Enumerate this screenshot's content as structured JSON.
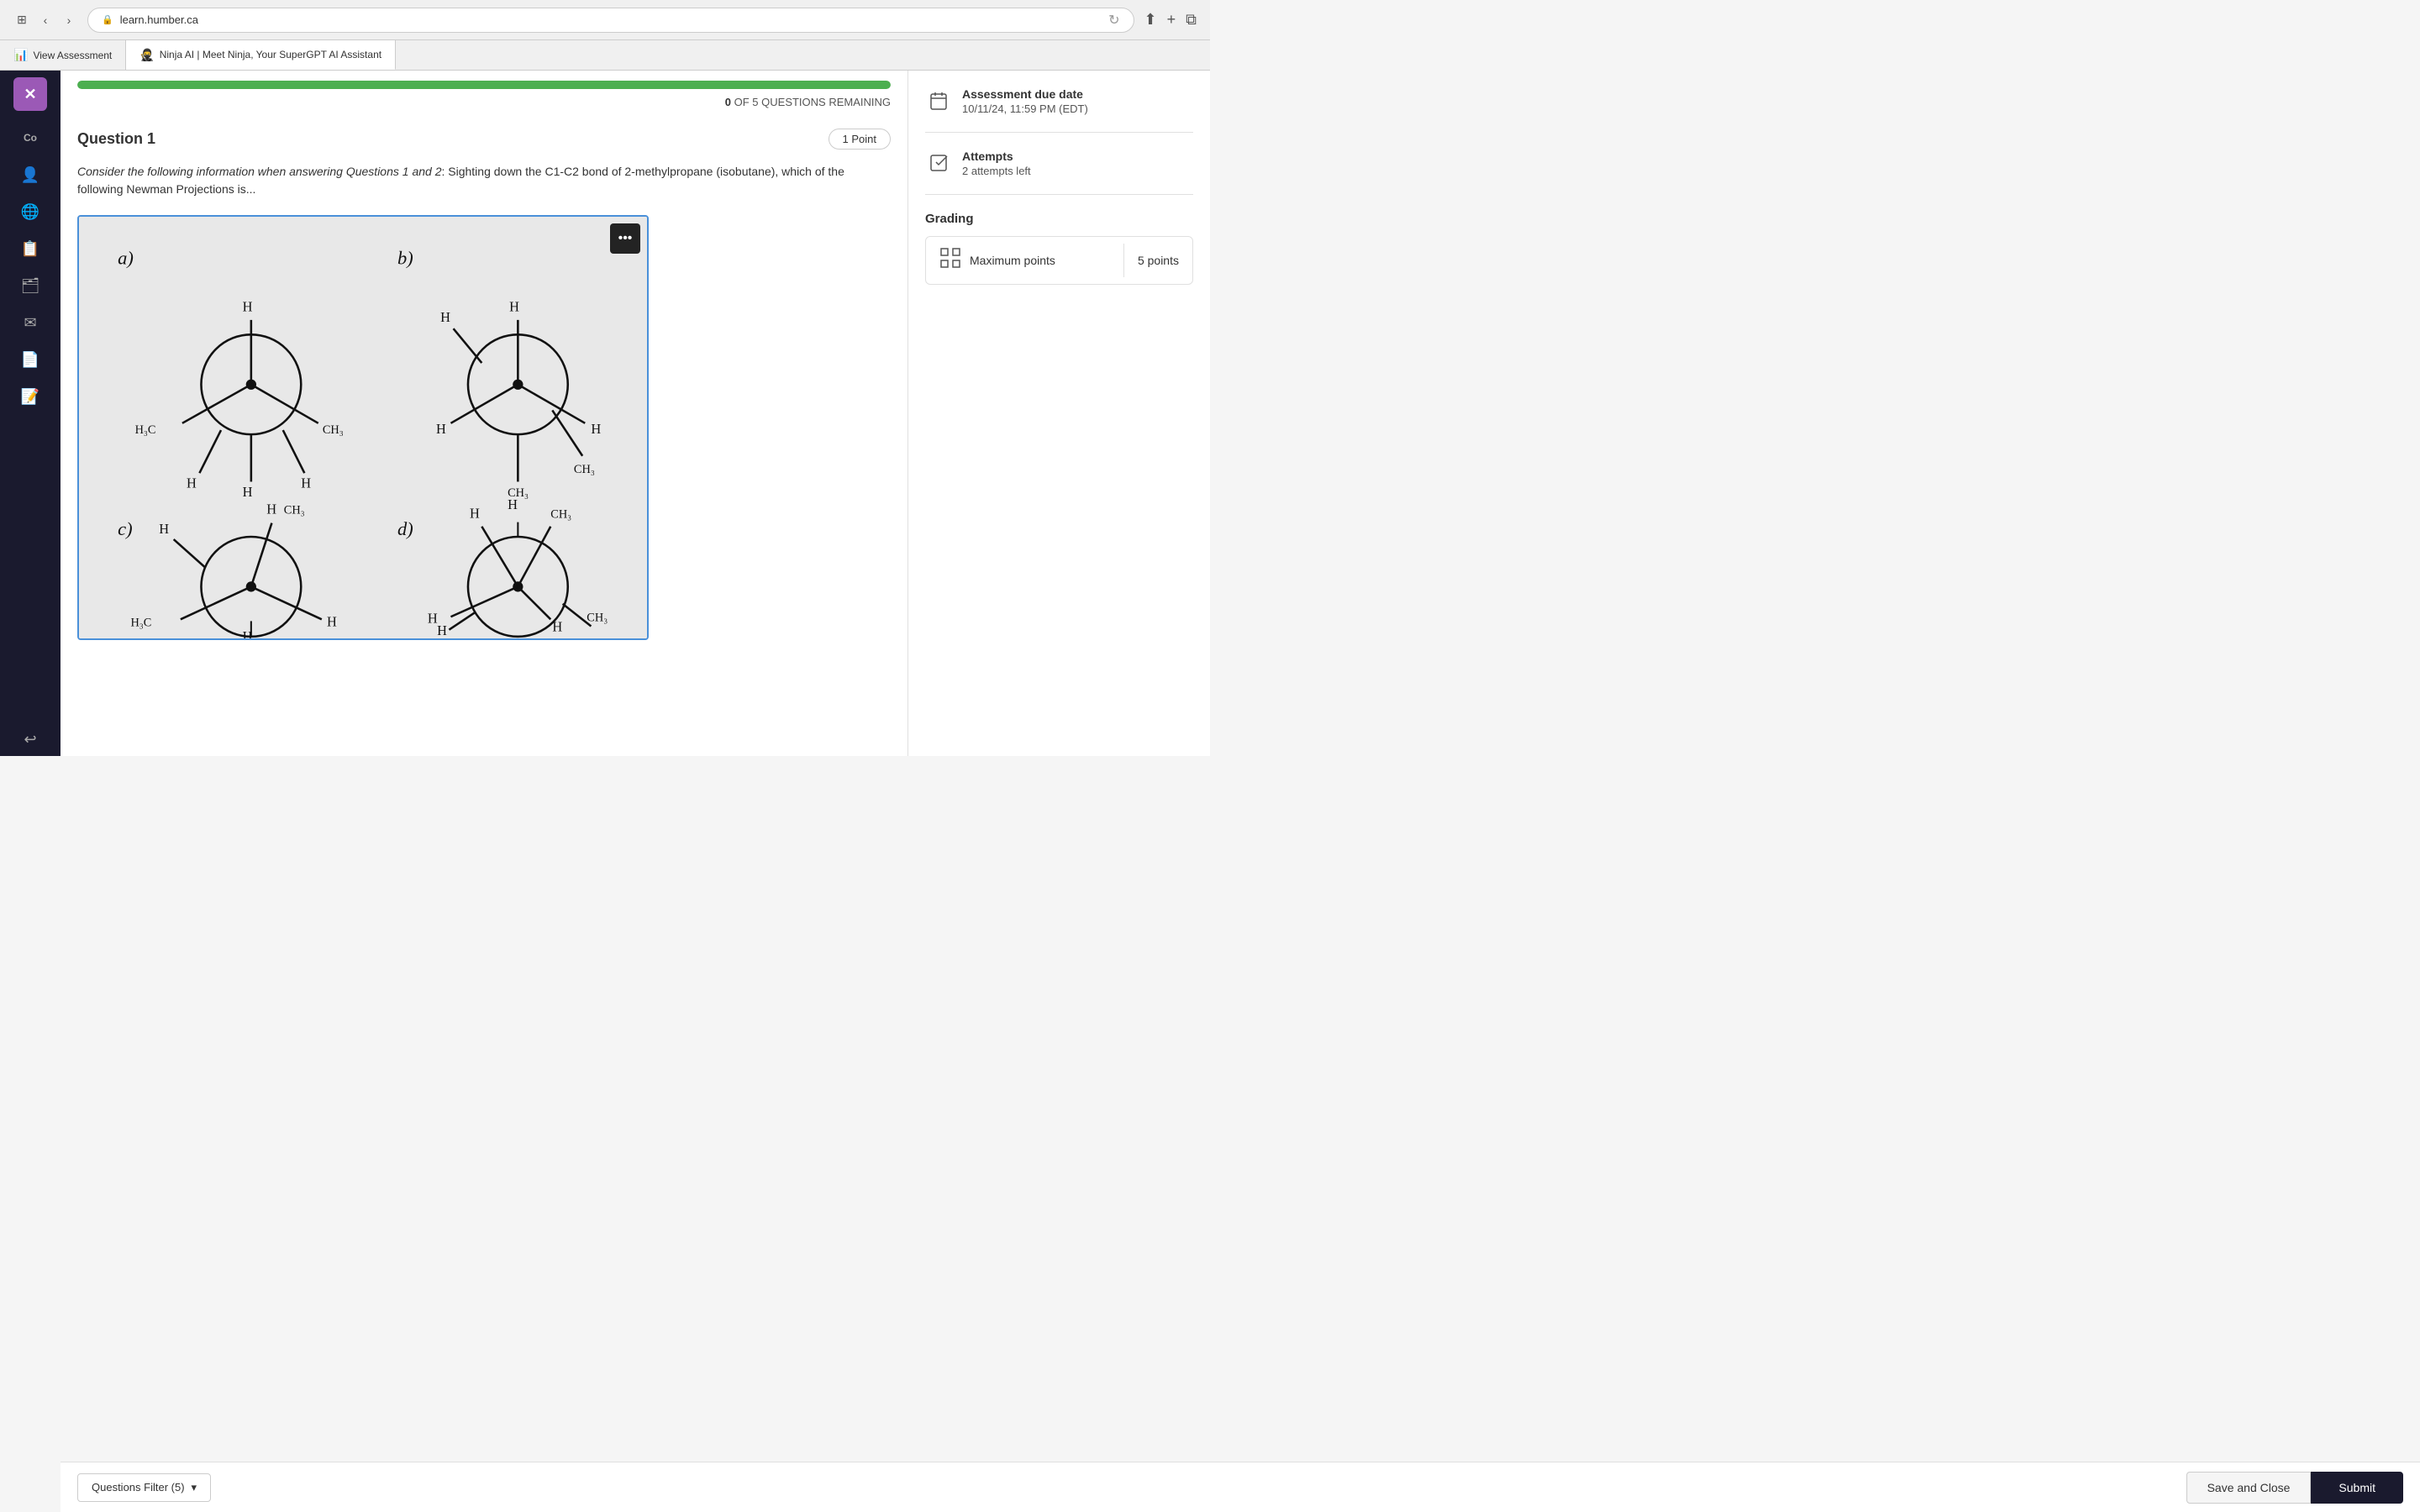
{
  "browser": {
    "url": "learn.humber.ca",
    "lock_icon": "🔒",
    "back_btn": "‹",
    "forward_btn": "›",
    "sidebar_btn": "⊞",
    "share_btn": "⬆",
    "new_tab_btn": "+",
    "tabs_btn": "⧉"
  },
  "tabs": [
    {
      "id": "view-assessment",
      "label": "View Assessment",
      "icon": "📊",
      "active": false
    },
    {
      "id": "ninja-ai",
      "label": "Ninja AI | Meet Ninja, Your SuperGPT AI Assistant",
      "icon": "🥷",
      "active": true
    }
  ],
  "progress": {
    "percent": 100,
    "questions_remaining": "0",
    "total_questions": "5",
    "remaining_label": "OF 5 QUESTIONS REMAINING"
  },
  "question": {
    "title": "Question 1",
    "points": "1 Point",
    "italic_text": "Consider the following information when answering Questions 1 and 2",
    "body_text": ": Sighting down the C1-C2 bond of 2-methylpropane (isobutane), which of the following Newman Projections is...",
    "image_menu_icon": "⋯"
  },
  "sidebar_items": [
    {
      "icon": "Co",
      "label": ""
    },
    {
      "icon": "👤",
      "label": ""
    },
    {
      "icon": "🌐",
      "label": ""
    },
    {
      "icon": "📋",
      "label": ""
    },
    {
      "icon": "🗂",
      "label": ""
    },
    {
      "icon": "✉",
      "label": ""
    },
    {
      "icon": "📄",
      "label": ""
    },
    {
      "icon": "📝",
      "label": ""
    },
    {
      "icon": "↩",
      "label": ""
    }
  ],
  "right_panel": {
    "assessment_due_date": {
      "label": "Assessment due date",
      "value": "10/11/24, 11:59 PM (EDT)"
    },
    "attempts": {
      "label": "Attempts",
      "value": "2 attempts left"
    },
    "grading": {
      "title": "Grading",
      "maximum_points": {
        "label": "Maximum points",
        "value": "5 points"
      }
    }
  },
  "bottom_bar": {
    "filter_btn": "Questions Filter (5)",
    "filter_icon": "▾",
    "save_close_btn": "Save and Close",
    "submit_btn": "Submit"
  },
  "colors": {
    "progress_bar": "#4caf50",
    "sidebar_bg": "#1a1a2e",
    "close_btn_bg": "#9b59b6",
    "image_border": "#4a90d9",
    "submit_btn_bg": "#1a1a2e"
  }
}
